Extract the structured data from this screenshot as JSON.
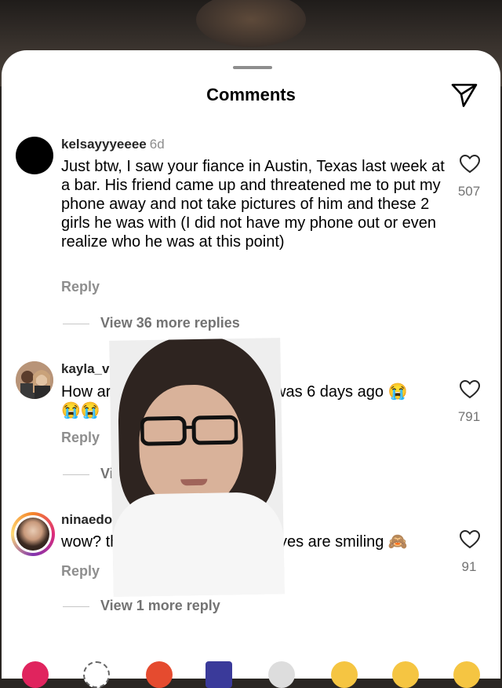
{
  "header": {
    "title": "Comments"
  },
  "comments": [
    {
      "username": "kelsayyyeeee",
      "time": "6d",
      "text": "Just btw, I saw your fiance in Austin, Texas last week at a bar. His friend came up and threatened me to put my phone away and not take pictures of him and these 2 girls he was with (I did not have my phone out or even realize who he was at this point)",
      "likes": "507",
      "reply_label": "Reply",
      "view_replies": "View 36 more replies"
    },
    {
      "username": "kayla_van",
      "text_start": "How are",
      "text_end": "is was 6 days ago 😭",
      "emojis": "😭😭",
      "likes": "791",
      "reply_label": "Reply",
      "view_replies": "Vi"
    },
    {
      "username": "ninaedo",
      "text_start": "wow? th",
      "text_end": "yes are smiling 🙈",
      "likes": "91",
      "reply_label": "Reply",
      "view_replies": "View 1 more reply"
    }
  ],
  "colors": {
    "accent_text": "#8e8e8e",
    "sheet": "#ffffff"
  },
  "icons": [
    "send-icon",
    "heart-icon"
  ]
}
